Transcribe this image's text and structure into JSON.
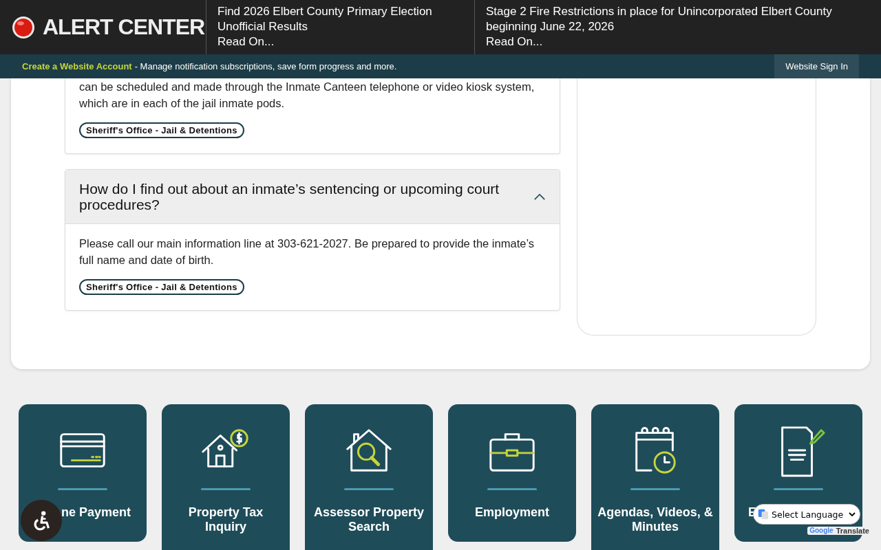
{
  "alert_center": {
    "title": "ALERT CENTER",
    "alerts": [
      {
        "headline": "Find 2026 Elbert County Primary Election Unofficial Results",
        "link": "Read On..."
      },
      {
        "headline": "Stage 2 Fire Restrictions in place for Unincorporated Elbert County beginning June 22, 2026",
        "link": "Read On..."
      }
    ]
  },
  "account_bar": {
    "link": "Create a Website Account",
    "text": "- Manage notification subscriptions, save form progress and more.",
    "sign_in": "Website Sign In"
  },
  "faq": [
    {
      "answer": "can be scheduled and made through the Inmate Canteen telephone or video kiosk system, which are in each of the jail inmate pods.",
      "tag": "Sheriff's Office - Jail & Detentions"
    },
    {
      "question": "How do I find out about an inmate’s sentencing or upcoming court procedures?",
      "expanded": true,
      "answer": "Please call our main information line at 303-621-2027. Be prepared to provide the inmate’s full name and date of birth.",
      "tag": "Sheriff's Office - Jail & Detentions"
    }
  ],
  "tiles": [
    {
      "kind": "card",
      "label": "ne Payment"
    },
    {
      "kind": "house-tax",
      "label": "Property Tax Inquiry"
    },
    {
      "kind": "house-search",
      "label": "Assessor Property Search"
    },
    {
      "kind": "briefcase",
      "label": "Employment"
    },
    {
      "kind": "calendar",
      "label": "Agendas, Videos, & Minutes"
    },
    {
      "kind": "document",
      "label": "E"
    }
  ],
  "translate": {
    "select": "Select Language",
    "brand": "Google",
    "label": "Translate"
  }
}
